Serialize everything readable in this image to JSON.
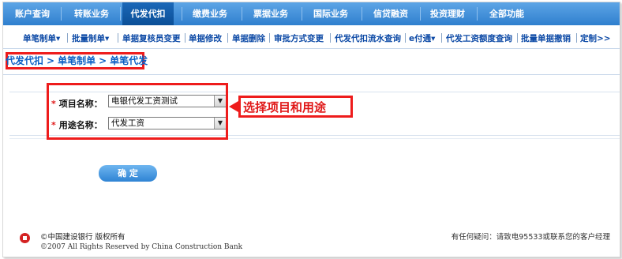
{
  "top_tabs": [
    {
      "label": "账户查询",
      "active": false
    },
    {
      "label": "转账业务",
      "active": false
    },
    {
      "label": "代发代扣",
      "active": true
    },
    {
      "label": "缴费业务",
      "active": false
    },
    {
      "label": "票据业务",
      "active": false
    },
    {
      "label": "国际业务",
      "active": false
    },
    {
      "label": "信贷融资",
      "active": false
    },
    {
      "label": "投资理财",
      "active": false
    },
    {
      "label": "全部功能",
      "active": false
    }
  ],
  "sub_menu": [
    "单笔制单▾",
    "批量制单▾",
    "单据复核员变更",
    "单据修改",
    "单据删除",
    "审批方式变更",
    "代发代扣流水查询",
    "e付通▾",
    "代发工资额度查询",
    "批量单据撤销",
    "定制>>"
  ],
  "breadcrumb": {
    "part1": "代发代扣",
    "part2": "单笔制单",
    "part3": "单笔代发",
    "sep": ">"
  },
  "form": {
    "project_label": "项目名称：",
    "project_value": "电银代发工资测试",
    "purpose_label": "用途名称：",
    "purpose_value": "代发工资",
    "required_mark": "*"
  },
  "callout": "选择项目和用途",
  "confirm_button": "确 定",
  "footer": {
    "bank_line": "©中国建设银行  版权所有",
    "copyright": "©2007 All Rights Reserved by China Construction Bank",
    "contact": "有任何疑问：请致电95533或联系您的客户经理"
  },
  "colors": {
    "nav_blue": "#2f7fce",
    "active_tab": "#0b4f97",
    "highlight_red": "#ee1c1c",
    "link_blue": "#0d4aa6"
  },
  "icons": {
    "select_arrow": "chevron-down-icon",
    "bank_logo": "ccb-logo-icon"
  }
}
